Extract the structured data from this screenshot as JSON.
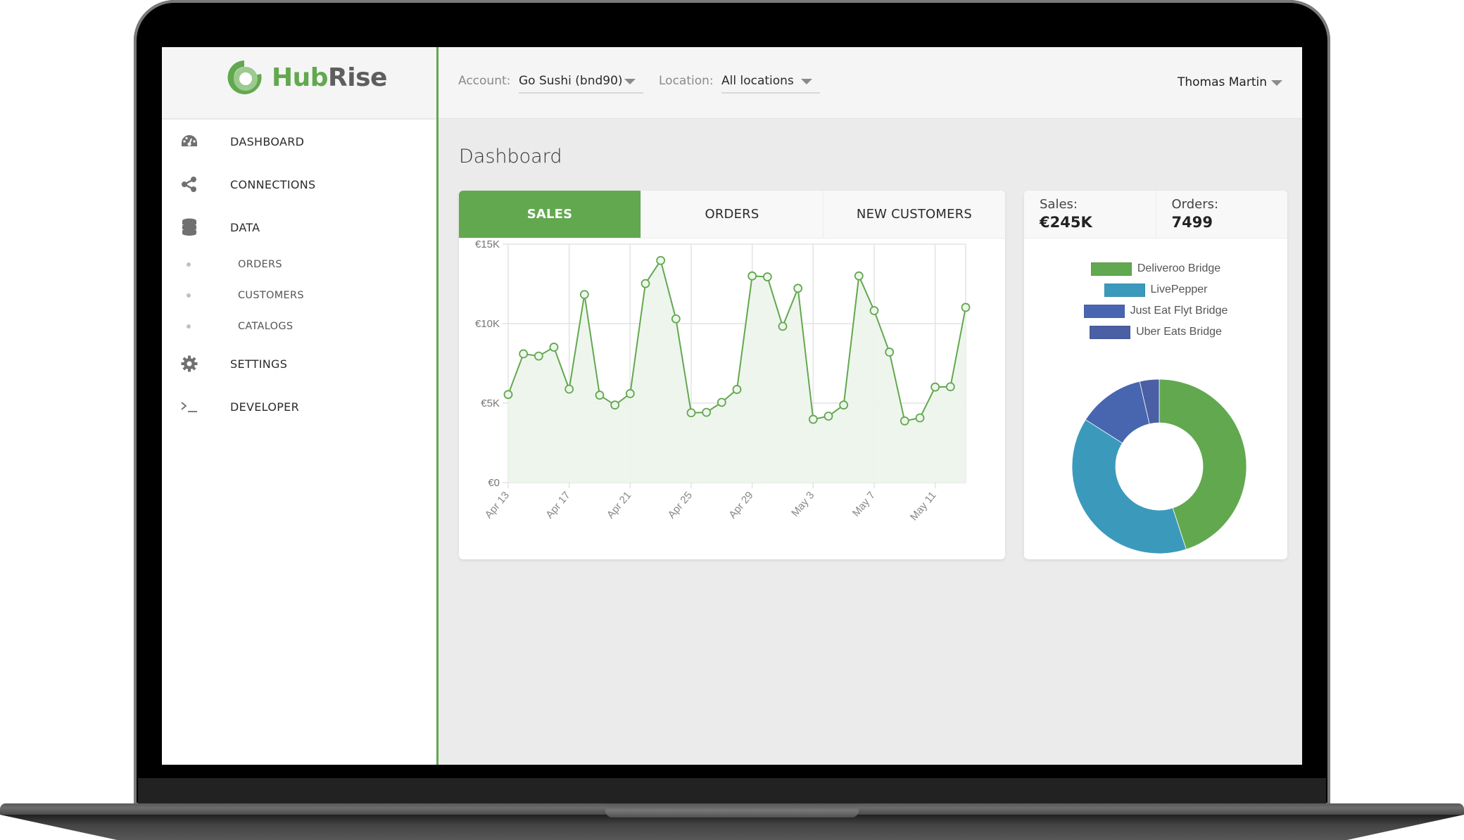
{
  "app": {
    "brand_part1": "Hub",
    "brand_part2": "Rise",
    "brand_color": "#62a84f"
  },
  "header": {
    "account_label": "Account:",
    "account_value": "Go Sushi (bnd90)",
    "location_label": "Location:",
    "location_value": "All locations",
    "user_name": "Thomas Martin"
  },
  "sidebar": {
    "items": [
      {
        "label": "DASHBOARD",
        "icon": "dashboard-gauge-icon"
      },
      {
        "label": "CONNECTIONS",
        "icon": "share-icon"
      },
      {
        "label": "DATA",
        "icon": "database-icon"
      },
      {
        "label": "ORDERS",
        "icon": "bullet-dot",
        "sub": true
      },
      {
        "label": "CUSTOMERS",
        "icon": "bullet-dot",
        "sub": true
      },
      {
        "label": "CATALOGS",
        "icon": "bullet-dot",
        "sub": true
      },
      {
        "label": "SETTINGS",
        "icon": "gear-icon"
      },
      {
        "label": "DEVELOPER",
        "icon": "terminal-icon"
      }
    ]
  },
  "page": {
    "title": "Dashboard"
  },
  "tabs": [
    {
      "label": "SALES",
      "active": true
    },
    {
      "label": "ORDERS",
      "active": false
    },
    {
      "label": "NEW CUSTOMERS",
      "active": false
    }
  ],
  "summary": {
    "sales_label": "Sales:",
    "sales_value": "€245K",
    "orders_label": "Orders:",
    "orders_value": "7499"
  },
  "chart_data": [
    {
      "type": "area",
      "title": "Sales",
      "xlabel": "",
      "ylabel": "",
      "ylim": [
        0,
        15000
      ],
      "yticks": [
        0,
        5000,
        10000,
        15000
      ],
      "ytick_labels": [
        "€0",
        "€5K",
        "€10K",
        "€15K"
      ],
      "xtick_labels": [
        "Apr 13",
        "Apr 17",
        "Apr 21",
        "Apr 25",
        "Apr 29",
        "May 3",
        "May 7",
        "May 11"
      ],
      "xtick_every": 4,
      "grid": true,
      "color": "#62a84f",
      "fill": "#edf4ec",
      "x": [
        "Apr 13",
        "Apr 14",
        "Apr 15",
        "Apr 16",
        "Apr 17",
        "Apr 18",
        "Apr 19",
        "Apr 20",
        "Apr 21",
        "Apr 22",
        "Apr 23",
        "Apr 24",
        "Apr 25",
        "Apr 26",
        "Apr 27",
        "Apr 28",
        "Apr 29",
        "Apr 30",
        "May 1",
        "May 2",
        "May 3",
        "May 4",
        "May 5",
        "May 6",
        "May 7",
        "May 8",
        "May 9",
        "May 10",
        "May 11",
        "May 12",
        "May 13"
      ],
      "values": [
        5540,
        8100,
        7960,
        8520,
        5880,
        11830,
        5500,
        4880,
        5600,
        12520,
        13970,
        10300,
        4390,
        4420,
        5050,
        5860,
        13000,
        12940,
        9830,
        12220,
        3980,
        4180,
        4880,
        13000,
        10820,
        8210,
        3880,
        4070,
        6010,
        6030,
        11020
      ]
    },
    {
      "type": "pie",
      "variant": "donut",
      "legend_position": "top",
      "labels": [
        "Deliveroo Bridge",
        "LivePepper",
        "Just Eat Flyt Bridge",
        "Uber Eats Bridge"
      ],
      "values": [
        45,
        39,
        12.4,
        3.6
      ],
      "colors": [
        "#62a84f",
        "#3b9abb",
        "#4866b0",
        "#4a5fa4"
      ]
    }
  ]
}
